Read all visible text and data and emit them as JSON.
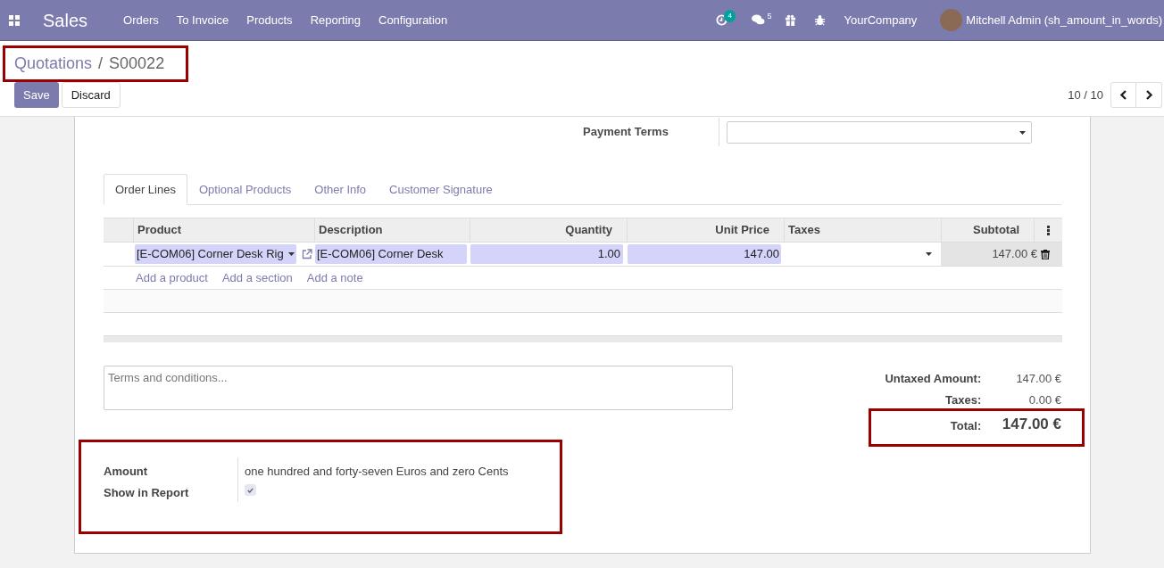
{
  "navbar": {
    "app_name": "Sales",
    "menu": [
      "Orders",
      "To Invoice",
      "Products",
      "Reporting",
      "Configuration"
    ],
    "activity_count": "4",
    "message_count": "5",
    "company": "YourCompany",
    "user": "Mitchell Admin (sh_amount_in_words)"
  },
  "breadcrumb": {
    "parent": "Quotations",
    "separator": "/",
    "current": "S00022"
  },
  "buttons": {
    "save": "Save",
    "discard": "Discard"
  },
  "pager": "10 / 10",
  "payment_terms": {
    "label": "Payment Terms"
  },
  "tabs": [
    {
      "label": "Order Lines",
      "selected": true
    },
    {
      "label": "Optional Products",
      "selected": false
    },
    {
      "label": "Other Info",
      "selected": false
    },
    {
      "label": "Customer Signature",
      "selected": false
    }
  ],
  "table": {
    "columns": [
      "Product",
      "Description",
      "Quantity",
      "Unit Price",
      "Taxes",
      "Subtotal"
    ],
    "rows": [
      {
        "product": "[E-COM06] Corner Desk Rig",
        "description": "[E-COM06] Corner Desk",
        "quantity": "1.00",
        "unit_price": "147.00",
        "subtotal": "147.00 €"
      }
    ],
    "add_links": [
      "Add a product",
      "Add a section",
      "Add a note"
    ]
  },
  "terms": {
    "placeholder": "Terms and conditions..."
  },
  "totals": [
    {
      "kind": "line",
      "label": "Untaxed Amount:",
      "value": "147.00 €"
    },
    {
      "kind": "line",
      "label": "Taxes:",
      "value": "0.00 €"
    },
    {
      "kind": "total",
      "label": "Total:",
      "value": "147.00 €"
    }
  ],
  "amount_in_words": {
    "label": "Amount",
    "value": "one hundred and forty-seven Euros and zero Cents"
  },
  "show_in_report": {
    "label": "Show in Report",
    "checked": true
  }
}
